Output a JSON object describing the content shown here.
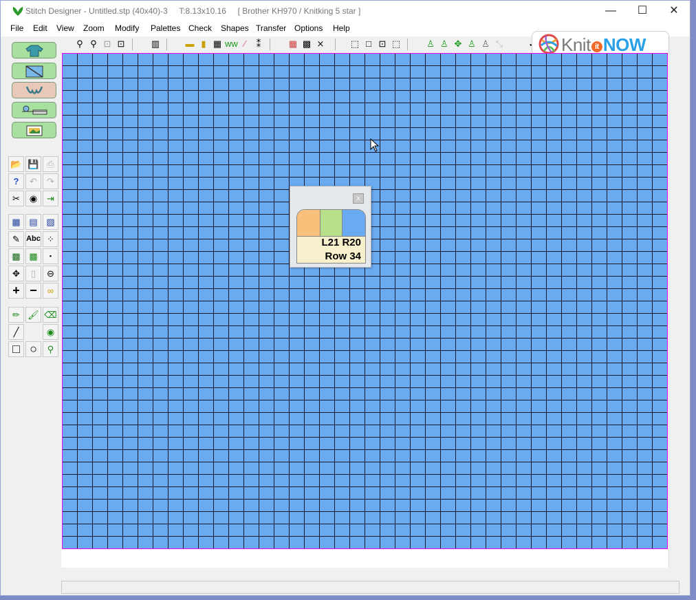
{
  "window": {
    "title": "Stitch Designer - Untitled.stp (40x40)-3     T:8.13x10.16     [ Brother KH970 / Knitking 5 star ]",
    "controls": {
      "minimize": "—",
      "maximize": "☐",
      "close": "✕"
    }
  },
  "menu": [
    "File",
    "Edit",
    "View",
    "Zoom",
    "Modify",
    "Palettes",
    "Check",
    "Shapes",
    "Transfer",
    "Options",
    "Help"
  ],
  "logo": {
    "knit": "Knit",
    "it": "it",
    "now": "NOW"
  },
  "toolbar_icons": [
    "zoom-in-icon",
    "zoom-out-icon",
    "zoom-fit-icon",
    "zoom-window-icon",
    "print-preview-icon",
    "horizontal-ruler-icon",
    "vertical-ruler-icon",
    "grid-icon",
    "pattern-icon",
    "rainbow-colors-icon",
    "symbols-icon",
    "palette-grid-icon",
    "chart-grid-icon",
    "cross-pattern-icon",
    "select-icon",
    "rectangle-select-icon",
    "center-select-icon",
    "transform-select-icon",
    "garment-icon-1",
    "garment-icon-2",
    "garment-move-icon",
    "garment-icon-3",
    "garment-icon-4",
    "garment-disabled-icon",
    "check-icon"
  ],
  "tool_glyphs": {
    "open": "📂",
    "save": "💾",
    "print": "⎙",
    "help": "?",
    "undo": "↶",
    "redo": "↷",
    "cut": "✂",
    "camera": "◉",
    "export": "⇥",
    "pattern1": "▦",
    "pattern2": "▤",
    "pattern3": "▧",
    "brush-text": "✎",
    "text": "Abc",
    "dots": "⁘",
    "checker1": "▩",
    "checker2": "▩",
    "dot": "▪",
    "move": "✥",
    "blank": "▯",
    "zoom-shape": "⊖",
    "plus": "+",
    "minus": "−",
    "lasso": "∞",
    "pencil": "✏",
    "paintbrush": "🖌",
    "eraser": "⌫",
    "line": "╱",
    "fill": "◉",
    "rectangle": "□",
    "circle": "○",
    "eyedropper": "⚲"
  },
  "popup": {
    "close_label": "x",
    "line1": "L21 R20",
    "line2": "Row 34",
    "swatches": [
      "#f8c07a",
      "#b6e08a",
      "#6aaaf2"
    ]
  },
  "colors": {
    "grid_fill": "#69aaf1",
    "grid_lines": "#1a1a2e",
    "grid_border": "#ee00ee"
  }
}
